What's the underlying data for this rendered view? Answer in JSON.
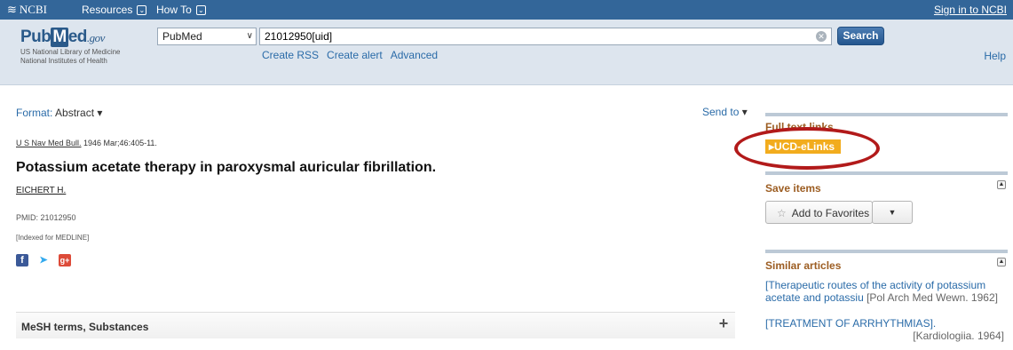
{
  "ncbi_bar": {
    "logo_text": "NCBI",
    "resources": "Resources",
    "howto": "How To",
    "caret_glyph": "⌄",
    "signin": "Sign in to NCBI"
  },
  "header": {
    "logo_pub": "Pub",
    "logo_m": "M",
    "logo_ed": "ed",
    "logo_gov": ".gov",
    "logo_sub1": "US National Library of Medicine",
    "logo_sub2": "National Institutes of Health",
    "database": "PubMed",
    "query": "21012950[uid]",
    "search_label": "Search",
    "links": [
      "Create RSS",
      "Create alert",
      "Advanced"
    ],
    "help": "Help"
  },
  "article": {
    "format_label": "Format:",
    "format_value": "Abstract",
    "send_to": "Send to",
    "journal": "U S Nav Med Bull.",
    "citation_rest": " 1946 Mar;46:405-11.",
    "title": "Potassium acetate therapy in paroxysmal auricular fibrillation.",
    "author": "EICHERT H.",
    "pmid": "PMID: 21012950",
    "indexed": "[Indexed for MEDLINE]",
    "mesh_label": "MeSH terms, Substances"
  },
  "sidebar": {
    "fulltext_head": "Full text links",
    "elink_label": "UCD-eLinks",
    "save_head": "Save items",
    "add_fav": "Add to Favorites",
    "similar_head": "Similar articles",
    "similar": [
      {
        "title": "[Therapeutic routes of the activity of potassium acetate and potassiu",
        "source": "[Pol Arch Med Wewn. 1962]"
      },
      {
        "title": "[TREATMENT OF ARRHYTHMIAS].",
        "source": "[Kardiologiia. 1964]"
      }
    ]
  },
  "colors": {
    "ncbi_blue": "#336699",
    "link_blue": "#2a6ba8",
    "section_brown": "#9c5d22",
    "elink_orange": "#f2ac1d",
    "annotation_red": "#b21a1a"
  }
}
